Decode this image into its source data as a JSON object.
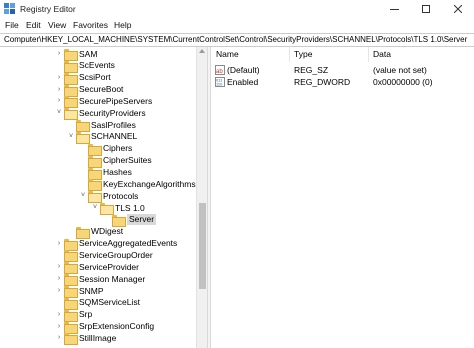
{
  "window": {
    "title": "Registry Editor"
  },
  "menu": [
    "File",
    "Edit",
    "View",
    "Favorites",
    "Help"
  ],
  "address": "Computer\\HKEY_LOCAL_MACHINE\\SYSTEM\\CurrentControlSet\\Control\\SecurityProviders\\SCHANNEL\\Protocols\\TLS 1.0\\Server",
  "tree": [
    {
      "label": "SAM",
      "depth": 0,
      "expander": "collapsed"
    },
    {
      "label": "ScEvents",
      "depth": 0,
      "expander": "none"
    },
    {
      "label": "ScsiPort",
      "depth": 0,
      "expander": "collapsed"
    },
    {
      "label": "SecureBoot",
      "depth": 0,
      "expander": "collapsed"
    },
    {
      "label": "SecurePipeServers",
      "depth": 0,
      "expander": "collapsed"
    },
    {
      "label": "SecurityProviders",
      "depth": 0,
      "expander": "expanded"
    },
    {
      "label": "SaslProfiles",
      "depth": 1,
      "expander": "none"
    },
    {
      "label": "SCHANNEL",
      "depth": 1,
      "expander": "expanded"
    },
    {
      "label": "Ciphers",
      "depth": 2,
      "expander": "none"
    },
    {
      "label": "CipherSuites",
      "depth": 2,
      "expander": "none"
    },
    {
      "label": "Hashes",
      "depth": 2,
      "expander": "none"
    },
    {
      "label": "KeyExchangeAlgorithms",
      "depth": 2,
      "expander": "none"
    },
    {
      "label": "Protocols",
      "depth": 2,
      "expander": "expanded"
    },
    {
      "label": "TLS 1.0",
      "depth": 3,
      "expander": "expanded"
    },
    {
      "label": "Server",
      "depth": 4,
      "expander": "none",
      "selected": true
    },
    {
      "label": "WDigest",
      "depth": 1,
      "expander": "none"
    },
    {
      "label": "ServiceAggregatedEvents",
      "depth": 0,
      "expander": "collapsed"
    },
    {
      "label": "ServiceGroupOrder",
      "depth": 0,
      "expander": "none"
    },
    {
      "label": "ServiceProvider",
      "depth": 0,
      "expander": "collapsed"
    },
    {
      "label": "Session Manager",
      "depth": 0,
      "expander": "collapsed"
    },
    {
      "label": "SNMP",
      "depth": 0,
      "expander": "collapsed"
    },
    {
      "label": "SQMServiceList",
      "depth": 0,
      "expander": "none"
    },
    {
      "label": "Srp",
      "depth": 0,
      "expander": "collapsed"
    },
    {
      "label": "SrpExtensionConfig",
      "depth": 0,
      "expander": "collapsed"
    },
    {
      "label": "StillImage",
      "depth": 0,
      "expander": "collapsed"
    }
  ],
  "values": {
    "headers": {
      "name": "Name",
      "type": "Type",
      "data": "Data"
    },
    "rows": [
      {
        "name": "(Default)",
        "type": "REG_SZ",
        "data": "(value not set)",
        "icon": "string-value-icon"
      },
      {
        "name": "Enabled",
        "type": "REG_DWORD",
        "data": "0x00000000 (0)",
        "icon": "binary-value-icon"
      }
    ]
  },
  "icons": {
    "app": "registry-editor-icon",
    "minimize": "minimize-icon",
    "maximize": "maximize-icon",
    "close": "close-icon",
    "folder": "folder-icon"
  },
  "colors": {
    "folder": "#f6d679",
    "selection": "#d9d9d9",
    "scrollbar_thumb": "#c1c1c1"
  }
}
